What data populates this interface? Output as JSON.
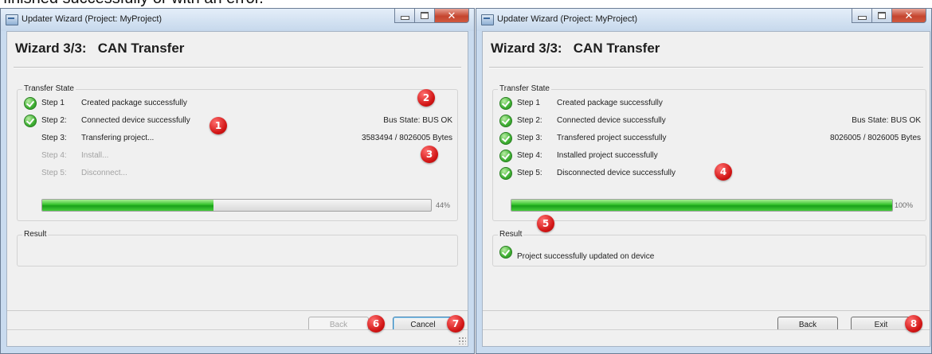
{
  "caption": "finished successfully or with an error.",
  "windows": [
    {
      "title": "Updater Wizard (Project: MyProject)",
      "wizard_title": "Wizard 3/3:   CAN Transfer",
      "transfer_label": "Transfer State",
      "steps": [
        {
          "num": "Step 1",
          "desc": "Created package successfully",
          "state": "done"
        },
        {
          "num": "Step 2:",
          "desc": "Connected device successfully",
          "state": "done"
        },
        {
          "num": "Step 3:",
          "desc": "Transfering project...",
          "state": "active"
        },
        {
          "num": "Step 4:",
          "desc": "Install...",
          "state": "pending"
        },
        {
          "num": "Step 5:",
          "desc": "Disconnect...",
          "state": "pending"
        }
      ],
      "bus_state": "Bus State: BUS OK",
      "bytes": "3583494 / 8026005 Bytes",
      "progress_percent": 44,
      "progress_label": "44%",
      "result_label": "Result",
      "result_text": "",
      "buttons": {
        "back": "Back",
        "cancel": "Cancel"
      },
      "badges": [
        "1",
        "2",
        "3",
        "6",
        "7"
      ]
    },
    {
      "title": "Updater Wizard (Project: MyProject)",
      "wizard_title": "Wizard 3/3:   CAN Transfer",
      "transfer_label": "Transfer State",
      "steps": [
        {
          "num": "Step 1",
          "desc": "Created package successfully",
          "state": "done"
        },
        {
          "num": "Step 2:",
          "desc": "Connected device successfully",
          "state": "done"
        },
        {
          "num": "Step 3:",
          "desc": "Transfered project successfully",
          "state": "done"
        },
        {
          "num": "Step 4:",
          "desc": "Installed project successfully",
          "state": "done"
        },
        {
          "num": "Step 5:",
          "desc": "Disconnected device successfully",
          "state": "done"
        }
      ],
      "bus_state": "Bus State: BUS OK",
      "bytes": "8026005 / 8026005 Bytes",
      "progress_percent": 100,
      "progress_label": "100%",
      "result_label": "Result",
      "result_text": "Project successfully updated on device",
      "buttons": {
        "back": "Back",
        "exit": "Exit"
      },
      "badges": [
        "4",
        "5",
        "8"
      ]
    }
  ],
  "colors": {
    "badge": "#d11414",
    "progress": "#34c22b",
    "check": "#3fb033"
  },
  "icons": [
    "app-icon",
    "minimize-icon",
    "maximize-icon",
    "close-icon",
    "check-icon",
    "resize-grip-icon"
  ]
}
